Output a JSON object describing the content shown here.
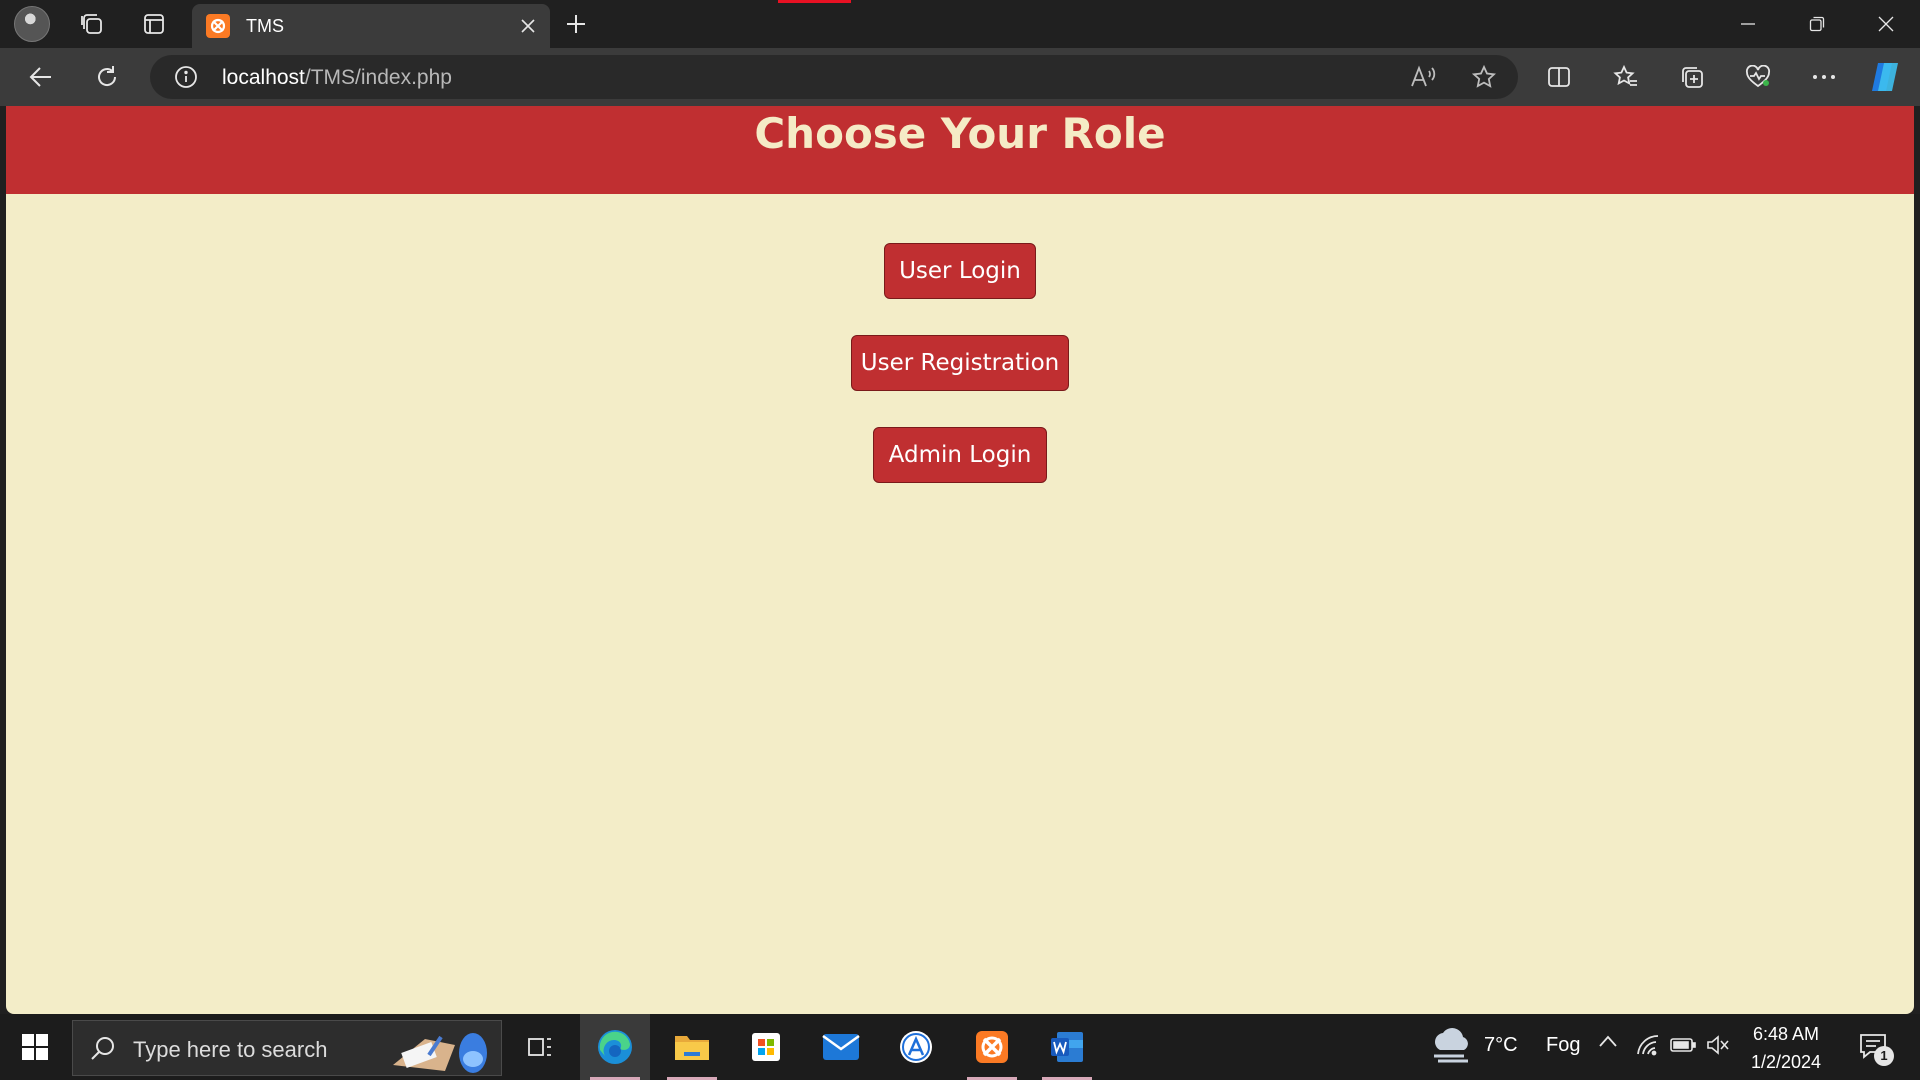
{
  "browser": {
    "tab": {
      "title": "TMS"
    },
    "address": {
      "host": "localhost",
      "path": "/TMS/index.php"
    }
  },
  "page": {
    "title": "Choose Your Role",
    "buttons": {
      "user_login": "User Login",
      "user_registration": "User Registration",
      "admin_login": "Admin Login"
    },
    "colors": {
      "header": "#c02f31",
      "background": "#f3edc8",
      "button": "#c02f31",
      "title_text": "#f5ebc6"
    }
  },
  "taskbar": {
    "search_placeholder": "Type here to search",
    "weather": {
      "temp": "7°C",
      "condition": "Fog"
    },
    "clock": {
      "time": "6:48 AM",
      "date": "1/2/2024"
    },
    "notification_count": "1"
  }
}
